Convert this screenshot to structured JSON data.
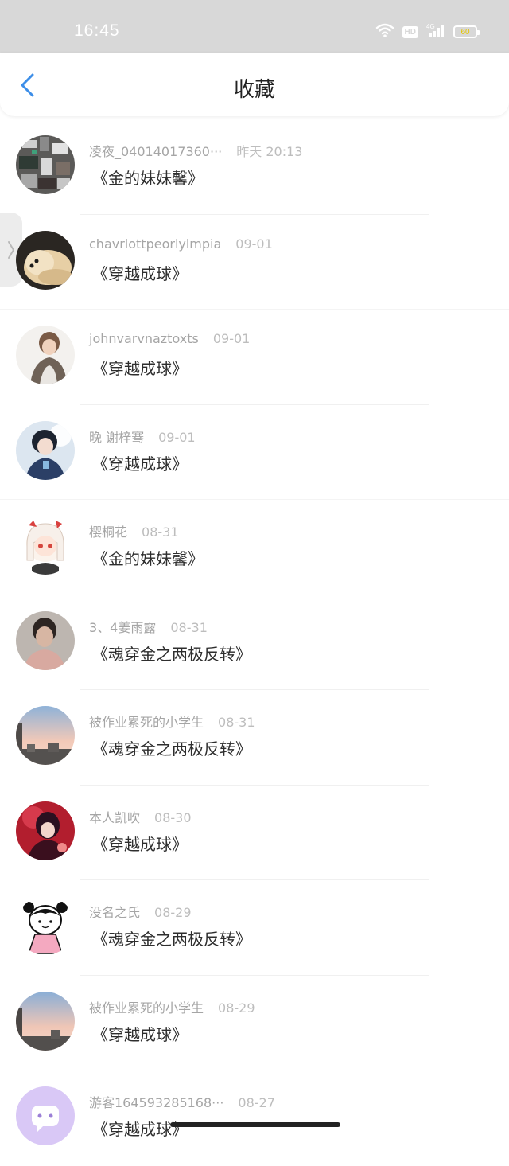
{
  "status": {
    "time": "16:45",
    "network": "4G",
    "hd": "HD",
    "battery": "60"
  },
  "header": {
    "title": "收藏"
  },
  "items": [
    {
      "user": "凌夜_04014017360···",
      "time": "昨天 20:13",
      "title": "《金的妹妹馨》"
    },
    {
      "user": "chavrlottpeorlylmpia",
      "time": "09-01",
      "title": "《穿越成球》"
    },
    {
      "user": "johnvarvnaztoxts",
      "time": "09-01",
      "title": "《穿越成球》"
    },
    {
      "user": "晚 谢梓骞",
      "time": "09-01",
      "title": "《穿越成球》"
    },
    {
      "user": "樱桐花",
      "time": "08-31",
      "title": "《金的妹妹馨》"
    },
    {
      "user": "3、4姜雨露",
      "time": "08-31",
      "title": "《魂穿金之两极反转》"
    },
    {
      "user": "被作业累死的小学生",
      "time": "08-31",
      "title": "《魂穿金之两极反转》"
    },
    {
      "user": "本人凯吹",
      "time": "08-30",
      "title": "《穿越成球》"
    },
    {
      "user": "没名之氏",
      "time": "08-29",
      "title": "《魂穿金之两极反转》"
    },
    {
      "user": "被作业累死的小学生",
      "time": "08-29",
      "title": "《穿越成球》"
    },
    {
      "user": "游客164593285168···",
      "time": "08-27",
      "title": "《穿越成球》"
    }
  ],
  "colors": {
    "accent": "#3d8ee8",
    "statusBar": "#d8d8d8"
  }
}
